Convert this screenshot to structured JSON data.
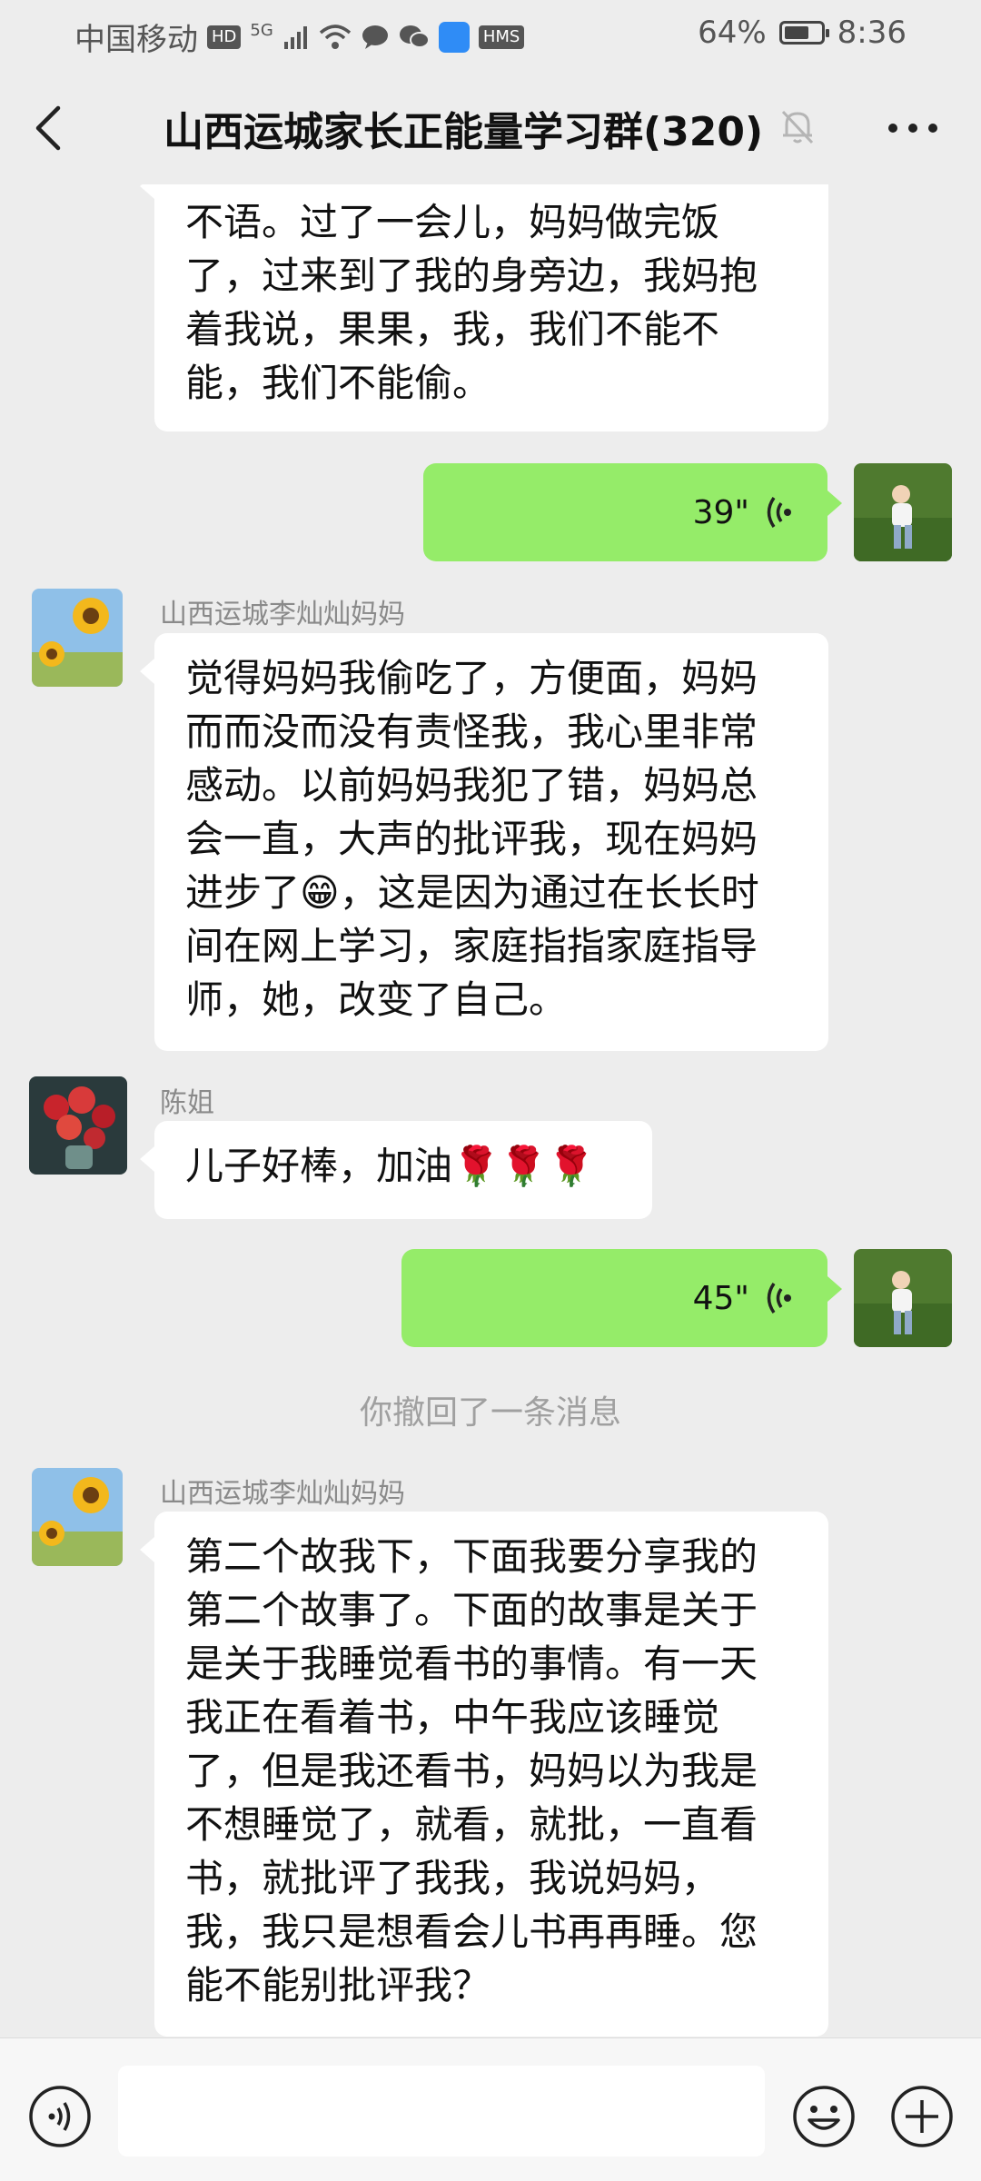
{
  "status_bar": {
    "carrier": "中国移动",
    "hd_badge": "HD",
    "network": "5G",
    "hms_badge": "HMS",
    "battery_percent": "64%",
    "battery_level": 0.64,
    "time": "8:36"
  },
  "header": {
    "title": "山西运城家长正能量学习群(320)",
    "icons": [
      "chevron-left-icon",
      "bell-muted-icon",
      "more-dots-icon"
    ]
  },
  "messages": [
    {
      "type": "text",
      "side": "left",
      "lines": [
        "不语。过了一会儿，妈妈做完饭",
        "了，过来到了我的身旁边，我妈抱",
        "着我说，果果，我，我们不能不",
        "能，我们不能偷。"
      ]
    },
    {
      "type": "voice",
      "side": "right",
      "duration": "39\""
    },
    {
      "type": "text",
      "side": "left",
      "sender": "山西运城李灿灿妈妈",
      "lines": [
        "觉得妈妈我偷吃了，方便面，妈妈",
        "而而没而没有责怪我，我心里非常",
        "感动。以前妈妈我犯了错，妈妈总",
        "会一直，大声的批评我，现在妈妈",
        "进步了😁，这是因为通过在长长时",
        "间在网上学习，家庭指指家庭指导",
        "师，她，改变了自己。"
      ]
    },
    {
      "type": "text",
      "side": "left",
      "sender": "陈姐",
      "lines": [
        "儿子好棒，加油🌹🌹🌹"
      ]
    },
    {
      "type": "voice",
      "side": "right",
      "duration": "45\""
    },
    {
      "type": "system",
      "text": "你撤回了一条消息"
    },
    {
      "type": "text",
      "side": "left",
      "sender": "山西运城李灿灿妈妈",
      "lines": [
        "第二个故我下，下面我要分享我的",
        "第二个故事了。下面的故事是关于",
        "是关于我睡觉看书的事情。有一天",
        "我正在看着书，中午我应该睡觉",
        "了，但是我还看书，妈妈以为我是",
        "不想睡觉了，就看，就批，一直看",
        "书，就批评了我我，我说妈妈，",
        "我，我只是想看会儿书再再睡。您",
        "能不能别批评我？"
      ]
    }
  ],
  "bottom_bar": {
    "icons": [
      "voice-input-icon",
      "emoji-icon",
      "plus-icon"
    ]
  },
  "colors": {
    "background": "#ededed",
    "self_bubble": "#95ec69",
    "other_bubble": "#ffffff",
    "system_text": "#a0a0a0"
  }
}
